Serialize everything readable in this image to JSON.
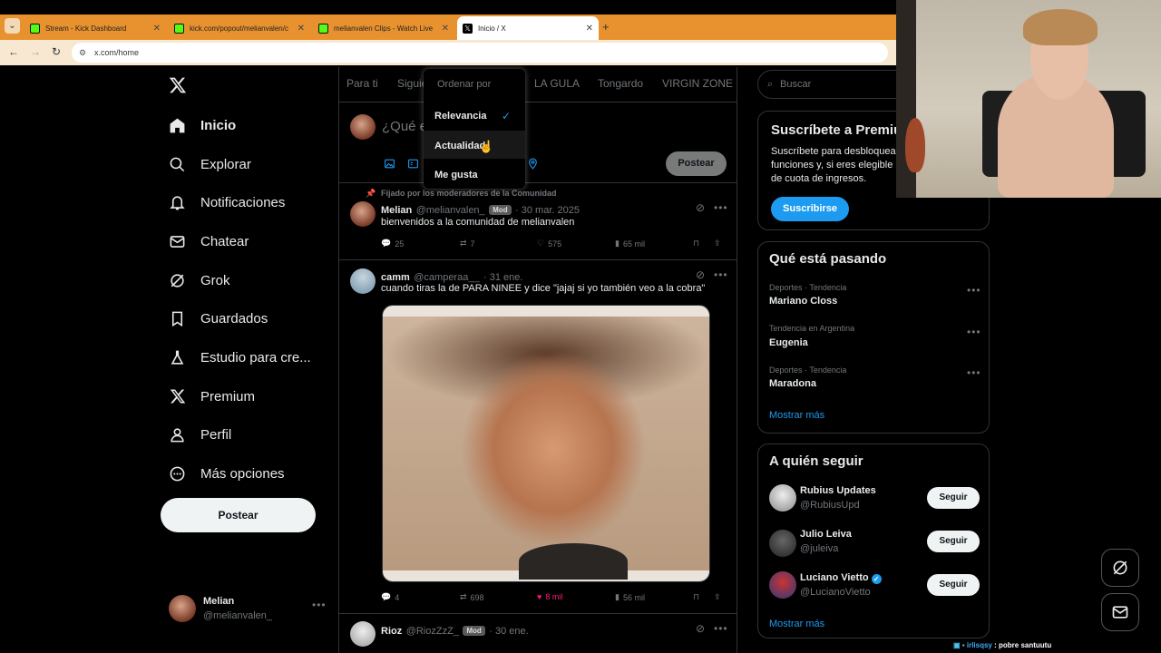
{
  "browser": {
    "tabs": [
      {
        "title": "Stream - Kick Dashboard",
        "icon": "kick-icon"
      },
      {
        "title": "kick.com/popout/melianvalen/c",
        "icon": "kick-icon"
      },
      {
        "title": "melianvalen Clips - Watch Live",
        "icon": "kick-icon"
      },
      {
        "title": "Inicio / X",
        "icon": "x-logo-icon",
        "active": true
      }
    ],
    "url": "x.com/home",
    "accent": "#e8922f"
  },
  "nav": {
    "items": [
      {
        "label": "Inicio",
        "icon": "home-icon"
      },
      {
        "label": "Explorar",
        "icon": "search-icon"
      },
      {
        "label": "Notificaciones",
        "icon": "bell-icon"
      },
      {
        "label": "Chatear",
        "icon": "mail-icon"
      },
      {
        "label": "Grok",
        "icon": "grok-icon"
      },
      {
        "label": "Guardados",
        "icon": "bookmark-icon"
      },
      {
        "label": "Estudio para cre...",
        "icon": "flask-icon"
      },
      {
        "label": "Premium",
        "icon": "x-logo-icon"
      },
      {
        "label": "Perfil",
        "icon": "person-icon"
      },
      {
        "label": "Más opciones",
        "icon": "more-circle-icon"
      }
    ],
    "post_label": "Postear",
    "account": {
      "name": "Melian",
      "handle": "@melianvalen_"
    }
  },
  "feed": {
    "tabs": [
      "Para ti",
      "Siguie",
      "LA GULA",
      "Tongardo",
      "VIRGIN ZONE"
    ],
    "compose_placeholder": "¿Qué e",
    "compose_post": "Postear",
    "dropdown": {
      "header": "Ordenar por",
      "options": [
        "Relevancia",
        "Actualidad",
        "Me gusta"
      ],
      "selected": "Relevancia"
    },
    "pinned_label": "Fijado por los moderadores de la Comunidad",
    "tweets": [
      {
        "name": "Melian",
        "handle": "@melianvalen_",
        "badge": "Mod",
        "date": "· 30 mar. 2025",
        "text": "bienvenidos a la comunidad de melianvalen",
        "replies": "25",
        "reposts": "7",
        "likes": "575",
        "views": "65 mil"
      },
      {
        "name": "camm",
        "handle": "@camperaa__",
        "date": "· 31 ene.",
        "text": "cuando tiras la de PARA NINEE y dice \"jajaj si yo también veo a la cobra\"",
        "replies": "4",
        "reposts": "698",
        "likes": "8 mil",
        "views": "56 mil"
      },
      {
        "name": "Rioz",
        "handle": "@RiozZzZ_",
        "badge": "Mod",
        "date": "· 30 ene."
      }
    ]
  },
  "right": {
    "search_placeholder": "Buscar",
    "premium": {
      "title": "Suscríbete a Premiu",
      "lines": [
        "Suscríbete para desbloquea",
        "funciones y, si eres elegible",
        "de cuota de ingresos."
      ],
      "button": "Suscribirse"
    },
    "trends": {
      "title": "Qué está pasando",
      "items": [
        {
          "category": "Deportes · Tendencia",
          "name": "Mariano Closs"
        },
        {
          "category": "Tendencia en Argentina",
          "name": "Eugenia"
        },
        {
          "category": "Deportes · Tendencia",
          "name": "Maradona"
        }
      ],
      "more": "Mostrar más"
    },
    "follow": {
      "title": "A quién seguir",
      "items": [
        {
          "name": "Rubius Updates",
          "handle": "@RubiusUpd"
        },
        {
          "name": "Julio Leiva",
          "handle": "@juleiva"
        },
        {
          "name": "Luciano Vietto",
          "handle": "@LucianoVietto",
          "verified": true
        }
      ],
      "button": "Seguir",
      "more": "Mostrar más"
    }
  },
  "overlay": {
    "chat_user": "irlisqsy",
    "chat_text": ": pobre santuutu"
  }
}
